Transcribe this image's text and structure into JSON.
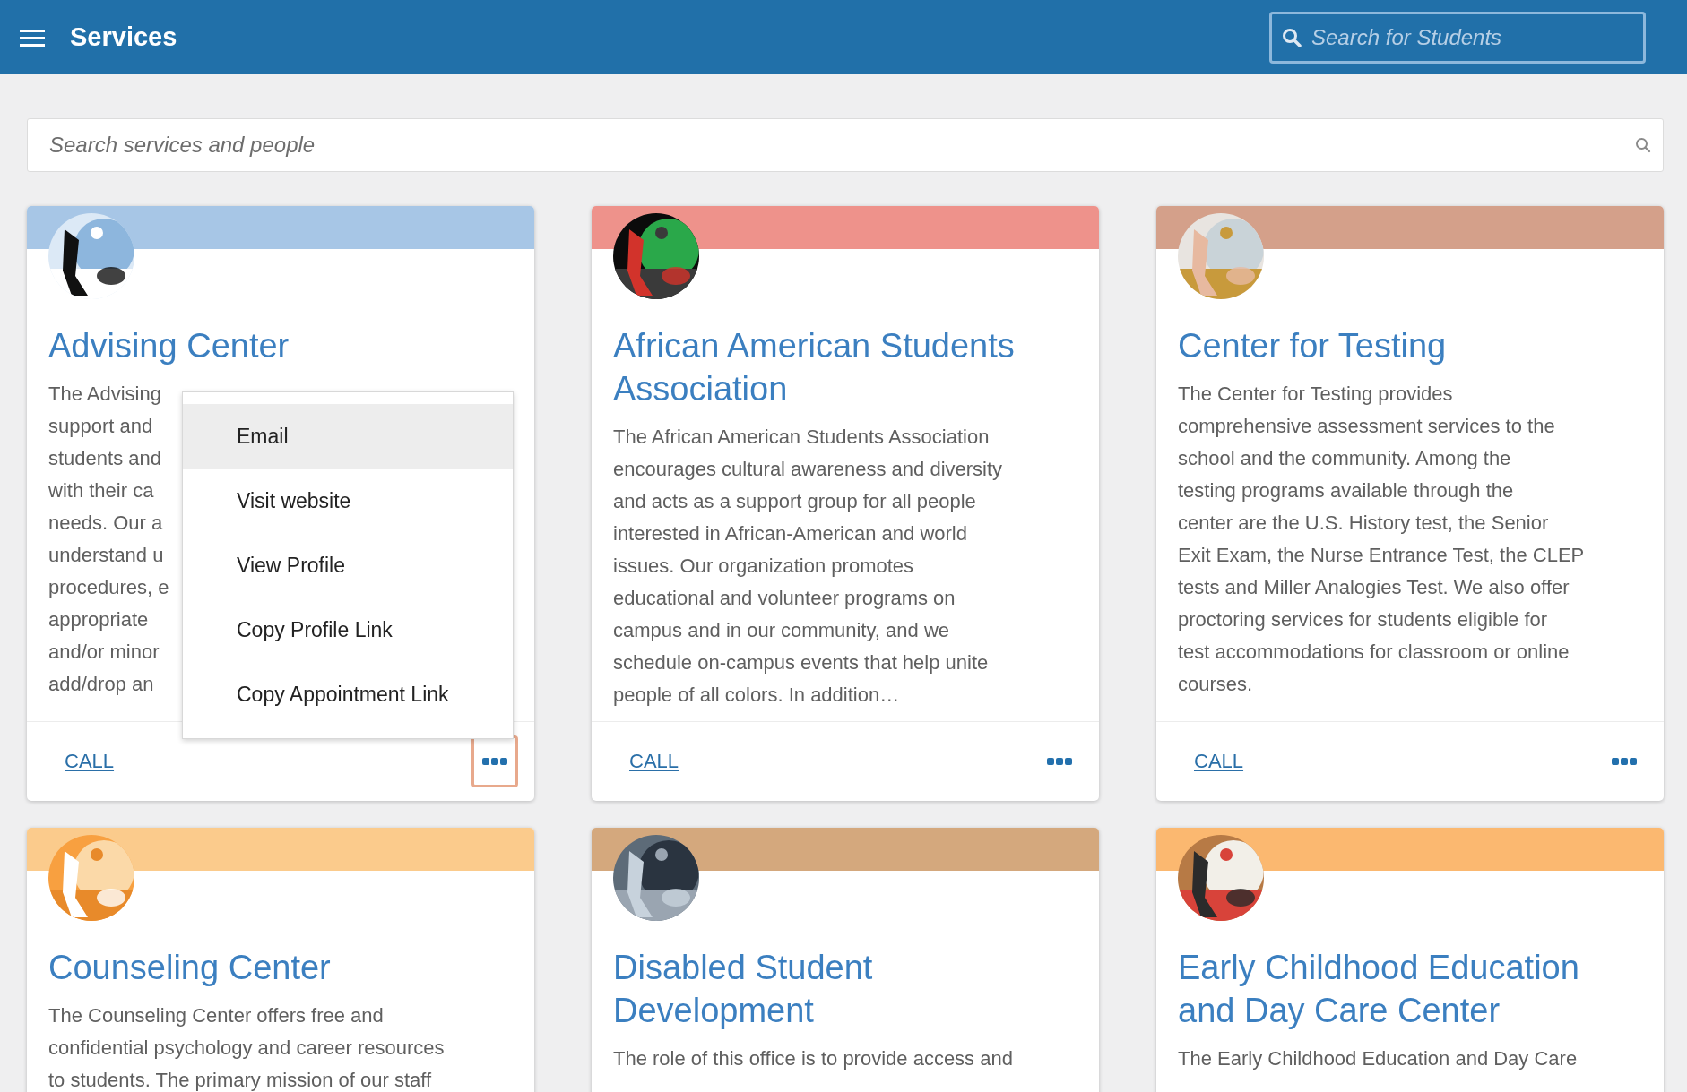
{
  "header": {
    "title": "Services",
    "search": {
      "placeholder": "Search for Students"
    }
  },
  "search": {
    "placeholder": "Search services and people"
  },
  "cards": [
    {
      "title": "Advising Center",
      "color": "#a7c6e6",
      "description_lines": [
        "The Advising",
        "support and",
        "students and",
        "with their ca",
        "needs. Our a",
        "understand u",
        "procedures, e",
        "appropriate",
        "and/or minor",
        "add/drop an"
      ],
      "call": "CALL",
      "more_focused": true,
      "menu_open": true
    },
    {
      "title": "African American Students Association",
      "color": "#ee928b",
      "description_lines": [
        "The African American Students Association",
        "encourages cultural awareness and diversity",
        "and acts as a support group for all people",
        "interested in African-American and world",
        "issues. Our organization promotes",
        "educational and volunteer programs on",
        "campus and in our community, and we",
        "schedule on-campus events that help unite",
        "people of all colors. In addition…"
      ],
      "call": "CALL",
      "more_focused": false,
      "menu_open": false
    },
    {
      "title": "Center for Testing",
      "color": "#d4a08a",
      "description_lines": [
        "The Center for Testing provides",
        "comprehensive assessment services to the",
        "school and the community. Among the",
        "testing programs available through the",
        "center are the U.S. History test, the Senior",
        "Exit Exam, the Nurse Entrance Test, the CLEP",
        "tests and Miller Analogies Test. We also offer",
        "proctoring services for students eligible for",
        "test accommodations for classroom or online",
        "courses."
      ],
      "call": "CALL",
      "more_focused": false,
      "menu_open": false
    },
    {
      "title": "Counseling Center",
      "color": "#fbcb8c",
      "description_lines": [
        "The Counseling Center offers free and",
        "confidential psychology and career resources",
        "to students. The primary mission of our staff"
      ]
    },
    {
      "title": "Disabled Student Development",
      "color": "#d4a87d",
      "description_lines": [
        "The role of this office is to provide access and"
      ]
    },
    {
      "title": "Early Childhood Education and Day Care Center",
      "color": "#fbb870",
      "description_lines": [
        "The Early Childhood Education and Day Care"
      ]
    }
  ],
  "menu": {
    "items": [
      {
        "label": "Email",
        "selected": true
      },
      {
        "label": "Visit website",
        "selected": false
      },
      {
        "label": "View Profile",
        "selected": false
      },
      {
        "label": "Copy Profile Link",
        "selected": false
      },
      {
        "label": "Copy Appointment Link",
        "selected": false
      }
    ]
  }
}
